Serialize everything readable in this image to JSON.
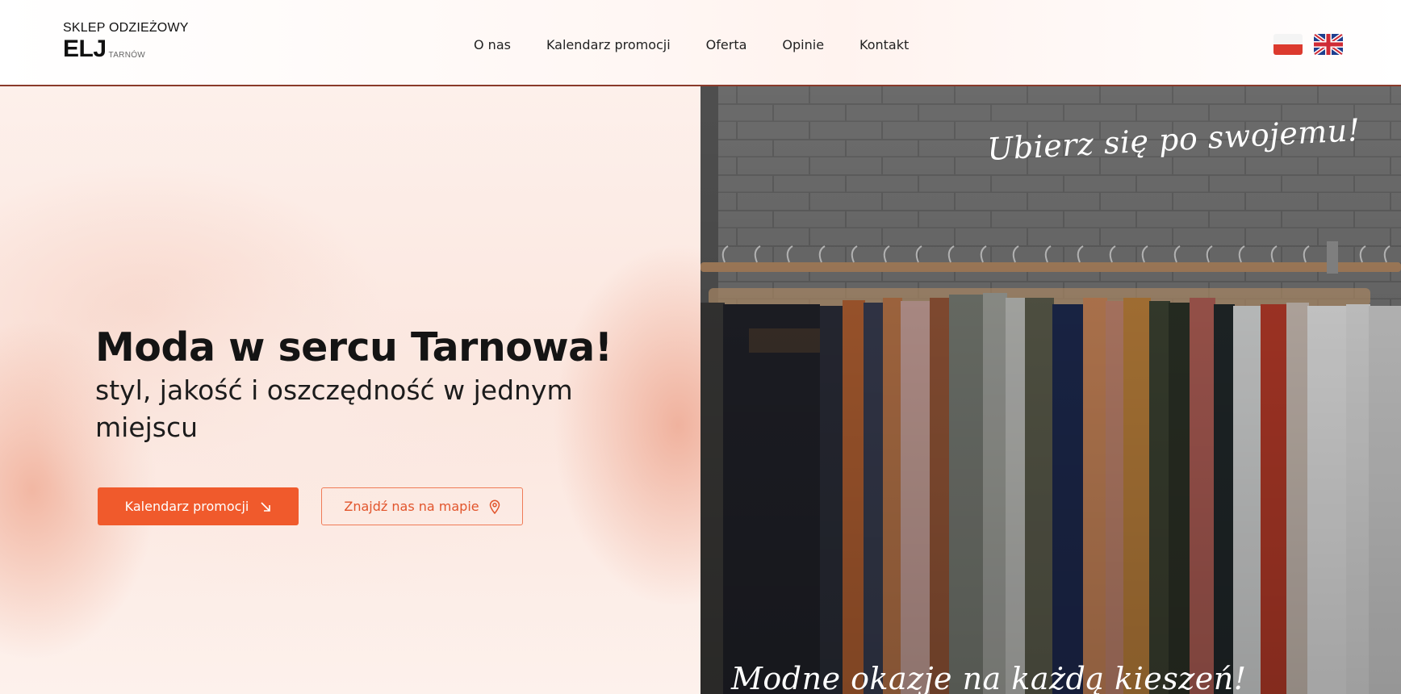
{
  "header": {
    "logo": {
      "top_line": "SKLEP ODZIEŻOWY",
      "main": "ELJ",
      "sub": "TARNÓW"
    },
    "nav": {
      "items": [
        {
          "label": "O nas"
        },
        {
          "label": "Kalendarz promocji"
        },
        {
          "label": "Oferta"
        },
        {
          "label": "Opinie"
        },
        {
          "label": "Kontakt"
        }
      ]
    },
    "languages": [
      {
        "code": "pl",
        "icon": "poland-flag-icon"
      },
      {
        "code": "en",
        "icon": "uk-flag-icon"
      }
    ]
  },
  "hero": {
    "title": "Moda w sercu Tarnowa!",
    "subtitle": "styl, jakość i oszczędność w jednym miejscu",
    "buttons": {
      "primary": {
        "label": "Kalendarz promocji",
        "icon": "arrow-down-right-icon"
      },
      "secondary": {
        "label": "Znajdź nas na mapie",
        "icon": "map-pin-icon"
      }
    },
    "image": {
      "tagline_top": "Ubierz się po swojemu!",
      "tagline_bottom": "Modne okazje na każdą kieszeń!"
    }
  },
  "colors": {
    "accent": "#f05a2c",
    "accent_outline": "#f07b57",
    "header_border": "#8a3a2a",
    "text_dark": "#141414"
  }
}
